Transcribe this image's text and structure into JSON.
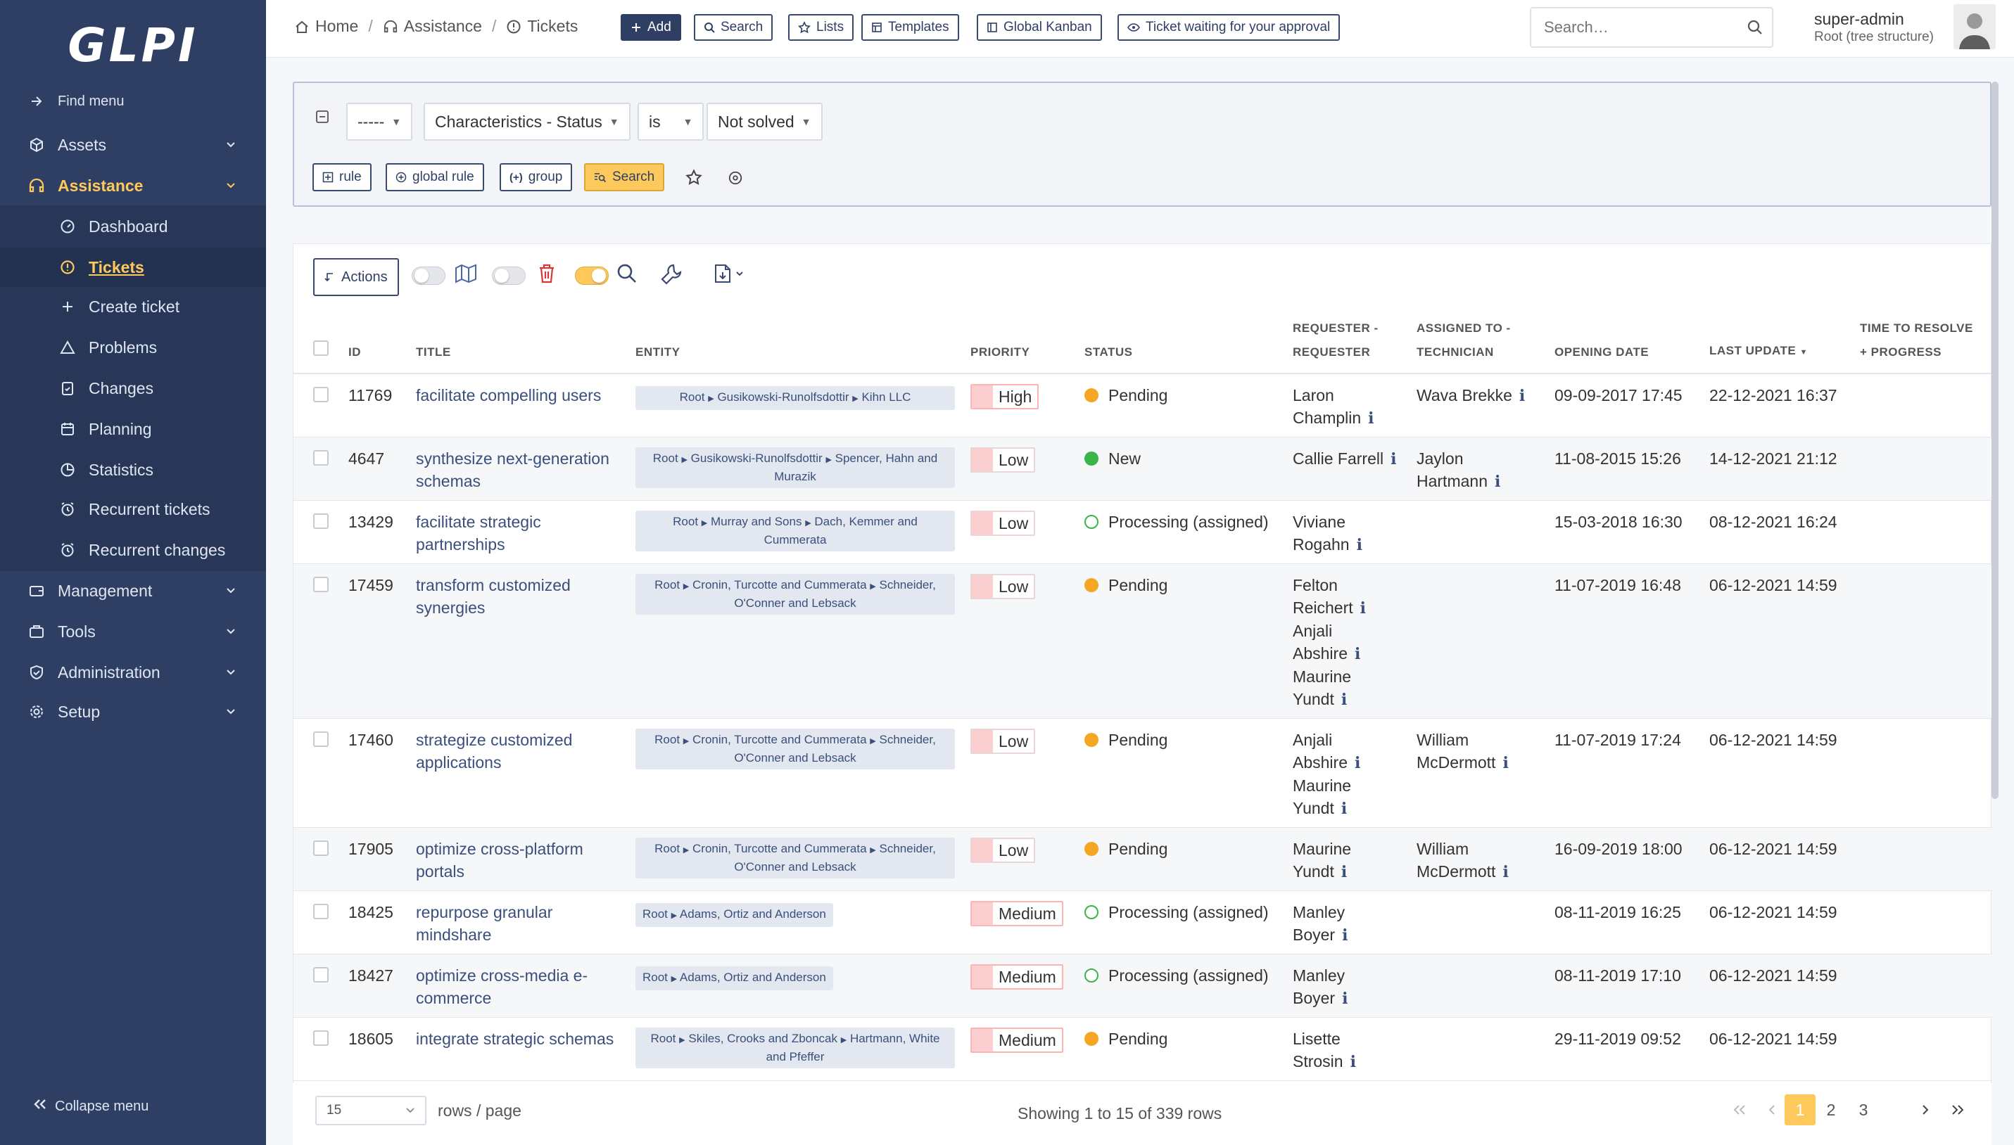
{
  "sidebar": {
    "logo": "GLPI",
    "find_menu": "Find menu",
    "items": [
      {
        "label": "Assets"
      },
      {
        "label": "Assistance"
      },
      {
        "label": "Dashboard"
      },
      {
        "label": "Tickets"
      },
      {
        "label": "Create ticket"
      },
      {
        "label": "Problems"
      },
      {
        "label": "Changes"
      },
      {
        "label": "Planning"
      },
      {
        "label": "Statistics"
      },
      {
        "label": "Recurrent tickets"
      },
      {
        "label": "Recurrent changes"
      },
      {
        "label": "Management"
      },
      {
        "label": "Tools"
      },
      {
        "label": "Administration"
      },
      {
        "label": "Setup"
      }
    ],
    "collapse": "Collapse menu"
  },
  "header": {
    "breadcrumb": [
      "Home",
      "Assistance",
      "Tickets"
    ],
    "buttons": [
      "Add",
      "Search",
      "Lists",
      "Templates",
      "Global Kanban",
      "Ticket waiting for your approval"
    ],
    "search_placeholder": "Search…",
    "user_name": "super-admin",
    "user_entity": "Root (tree structure)"
  },
  "criteria": {
    "link": "-----",
    "field": "Characteristics - Status",
    "operator": "is",
    "value": "Not solved",
    "buttons": [
      "rule",
      "global rule",
      "group",
      "Search"
    ]
  },
  "toolbar": {
    "actions_label": "Actions"
  },
  "table": {
    "headers": {
      "id": "ID",
      "title": "TITLE",
      "entity": "ENTITY",
      "priority": "PRIORITY",
      "status": "STATUS",
      "requester_1": "REQUESTER -",
      "requester_2": "REQUESTER",
      "assigned_1": "ASSIGNED TO -",
      "assigned_2": "TECHNICIAN",
      "opening": "OPENING DATE",
      "last_update": "LAST UPDATE",
      "ttr_1": "TIME TO RESOLVE",
      "ttr_2": "+ PROGRESS"
    },
    "rows": [
      {
        "id": "11769",
        "title": "facilitate compelling users",
        "entity": [
          "Root",
          "Gusikowski-Runolfsdottir",
          "Kihn LLC"
        ],
        "priority": "High",
        "status": "Pending",
        "status_kind": "pending",
        "requesters": [
          "Laron Champlin"
        ],
        "technicians": [
          "Wava Brekke"
        ],
        "opening": "09-09-2017 17:45",
        "last_update": "22-12-2021 16:37"
      },
      {
        "id": "4647",
        "title": "synthesize next-generation schemas",
        "entity": [
          "Root",
          "Gusikowski-Runolfsdottir",
          "Spencer, Hahn and Murazik"
        ],
        "priority": "Low",
        "status": "New",
        "status_kind": "new",
        "requesters": [
          "Callie Farrell"
        ],
        "technicians": [
          "Jaylon Hartmann"
        ],
        "opening": "11-08-2015 15:26",
        "last_update": "14-12-2021 21:12"
      },
      {
        "id": "13429",
        "title": "facilitate strategic partnerships",
        "entity": [
          "Root",
          "Murray and Sons",
          "Dach, Kemmer and Cummerata"
        ],
        "priority": "Low",
        "status": "Processing (assigned)",
        "status_kind": "processing",
        "requesters": [
          "Viviane Rogahn"
        ],
        "technicians": [],
        "opening": "15-03-2018 16:30",
        "last_update": "08-12-2021 16:24"
      },
      {
        "id": "17459",
        "title": "transform customized synergies",
        "entity": [
          "Root",
          "Cronin, Turcotte and Cummerata",
          "Schneider, O'Conner and Lebsack"
        ],
        "priority": "Low",
        "status": "Pending",
        "status_kind": "pending",
        "requesters": [
          "Felton Reichert",
          "Anjali Abshire",
          "Maurine Yundt"
        ],
        "technicians": [],
        "opening": "11-07-2019 16:48",
        "last_update": "06-12-2021 14:59"
      },
      {
        "id": "17460",
        "title": "strategize customized applications",
        "entity": [
          "Root",
          "Cronin, Turcotte and Cummerata",
          "Schneider, O'Conner and Lebsack"
        ],
        "priority": "Low",
        "status": "Pending",
        "status_kind": "pending",
        "requesters": [
          "Anjali Abshire",
          "Maurine Yundt"
        ],
        "technicians": [
          "William McDermott"
        ],
        "opening": "11-07-2019 17:24",
        "last_update": "06-12-2021 14:59"
      },
      {
        "id": "17905",
        "title": "optimize cross-platform portals",
        "entity": [
          "Root",
          "Cronin, Turcotte and Cummerata",
          "Schneider, O'Conner and Lebsack"
        ],
        "priority": "Low",
        "status": "Pending",
        "status_kind": "pending",
        "requesters": [
          "Maurine Yundt"
        ],
        "technicians": [
          "William McDermott"
        ],
        "opening": "16-09-2019 18:00",
        "last_update": "06-12-2021 14:59"
      },
      {
        "id": "18425",
        "title": "repurpose granular mindshare",
        "entity": [
          "Root",
          "Adams, Ortiz and Anderson"
        ],
        "priority": "Medium",
        "status": "Processing (assigned)",
        "status_kind": "processing",
        "requesters": [
          "Manley Boyer"
        ],
        "technicians": [],
        "opening": "08-11-2019 16:25",
        "last_update": "06-12-2021 14:59"
      },
      {
        "id": "18427",
        "title": "optimize cross-media e-commerce",
        "entity": [
          "Root",
          "Adams, Ortiz and Anderson"
        ],
        "priority": "Medium",
        "status": "Processing (assigned)",
        "status_kind": "processing",
        "requesters": [
          "Manley Boyer"
        ],
        "technicians": [],
        "opening": "08-11-2019 17:10",
        "last_update": "06-12-2021 14:59"
      },
      {
        "id": "18605",
        "title": "integrate strategic schemas",
        "entity": [
          "Root",
          "Skiles, Crooks and Zboncak",
          "Hartmann, White and Pfeffer"
        ],
        "priority": "Medium",
        "status": "Pending",
        "status_kind": "pending",
        "requesters": [
          "Lisette Strosin"
        ],
        "technicians": [],
        "opening": "29-11-2019 09:52",
        "last_update": "06-12-2021 14:59"
      }
    ]
  },
  "footer": {
    "per_page": "15",
    "per_page_label": "rows / page",
    "showing": "Showing 1 to 15 of 339 rows",
    "pages": [
      "1",
      "2",
      "3"
    ]
  },
  "colors": {
    "sidebar_bg": "#2f3f64",
    "accent": "#fec95c",
    "pending": "#f5a623",
    "new": "#3bb54a"
  }
}
